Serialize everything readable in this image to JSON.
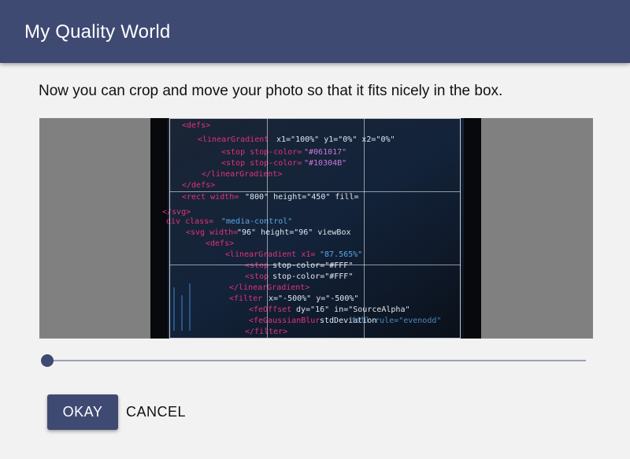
{
  "header": {
    "title": "My Quality World"
  },
  "instructions": "Now you can crop and move your photo so that it fits nicely in the box.",
  "photo": {
    "description_icon": "code-screen-photo"
  },
  "zoom": {
    "value": 0
  },
  "buttons": {
    "okay": "OKAY",
    "cancel": "CANCEL"
  },
  "colors": {
    "header": "#3f4a73",
    "accent": "#3f4a73",
    "crop_background": "#808080"
  }
}
